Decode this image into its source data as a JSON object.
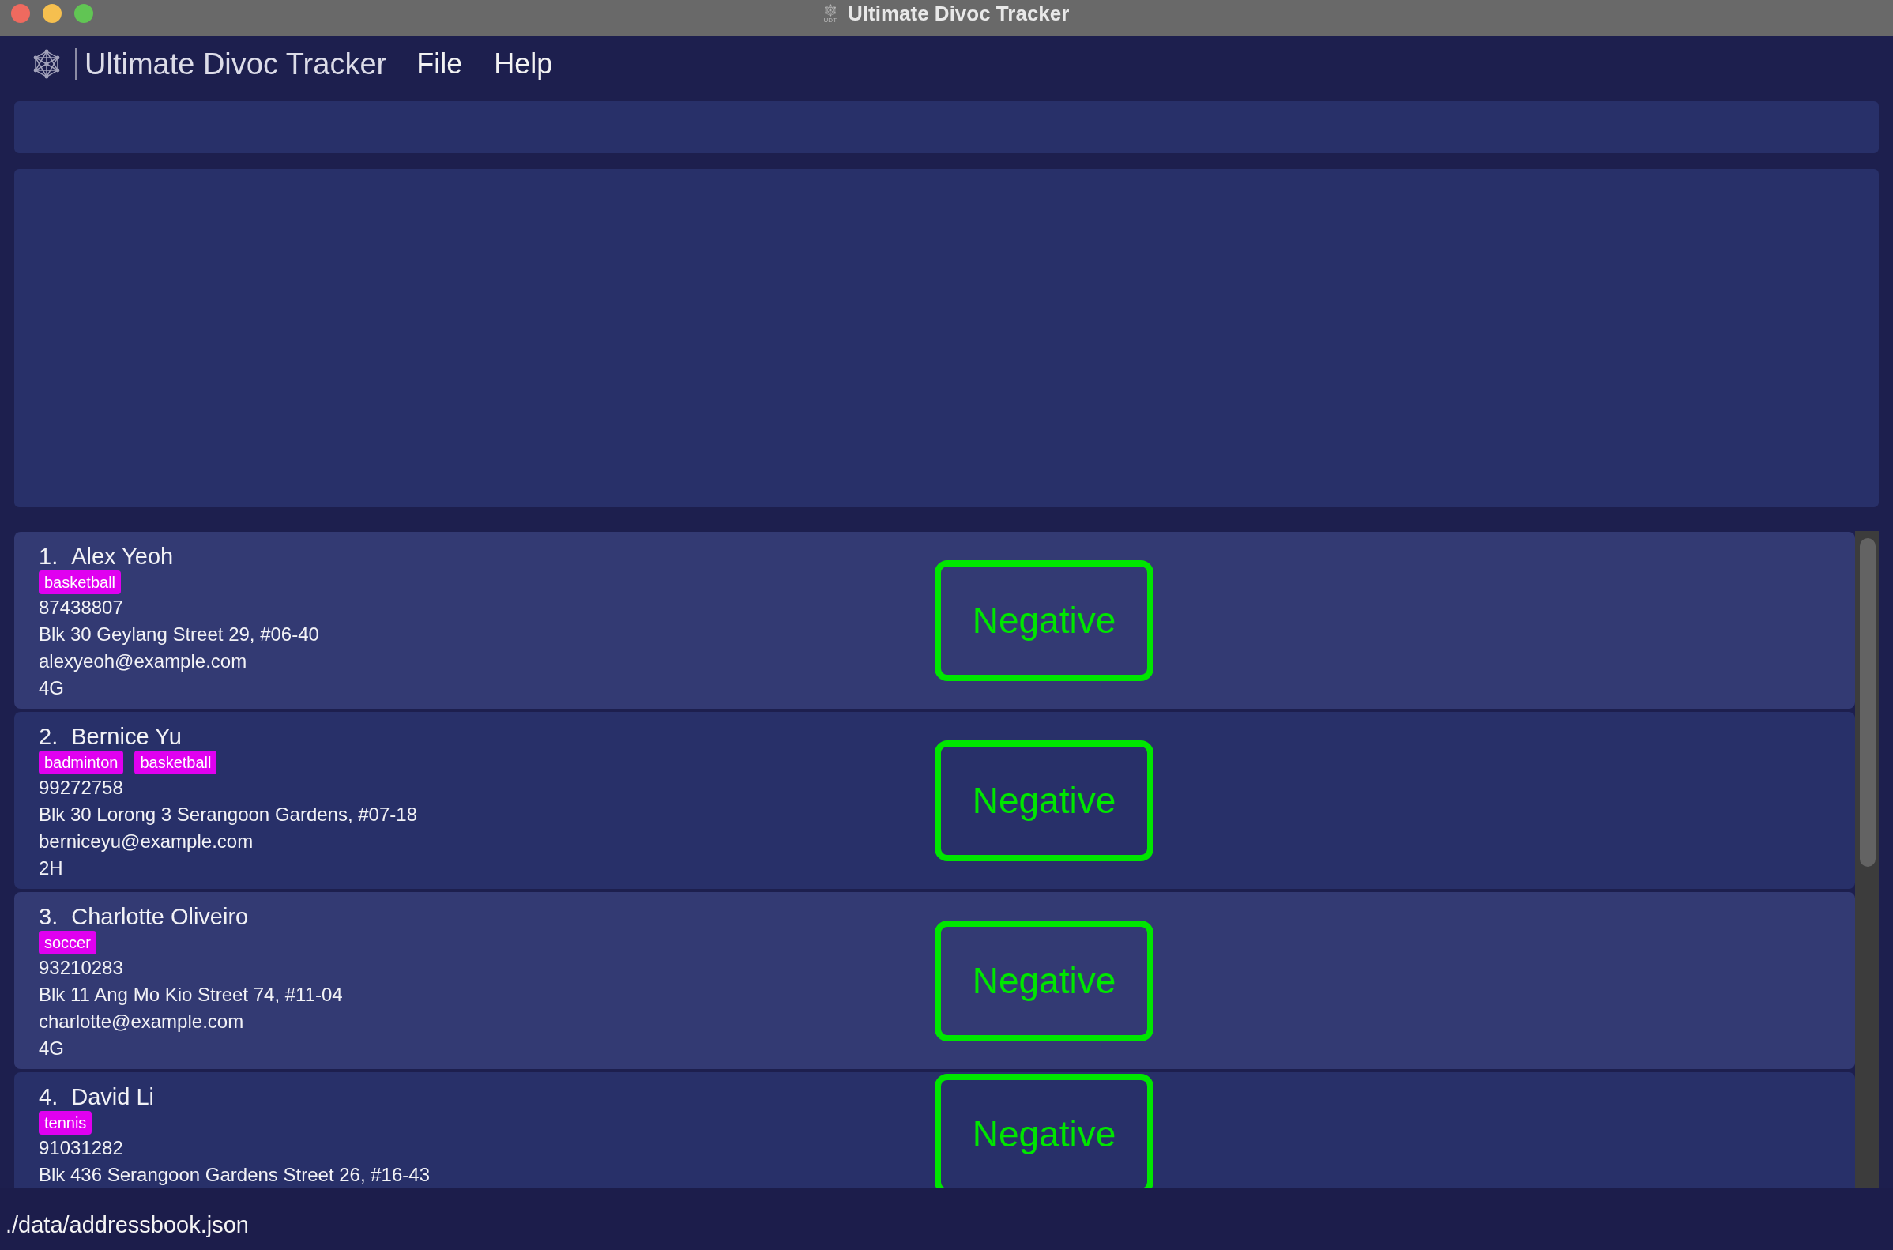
{
  "window": {
    "title": "Ultimate Divoc Tracker",
    "icon_caption": "UDT"
  },
  "menu_bar": {
    "app_name": "Ultimate Divoc Tracker",
    "menus": [
      "File",
      "Help"
    ]
  },
  "persons": [
    {
      "index": "1.",
      "name": "Alex Yeoh",
      "tags": [
        "basketball"
      ],
      "phone": "87438807",
      "address": "Blk 30 Geylang Street 29, #06-40",
      "email": "alexyeoh@example.com",
      "class": "4G",
      "status": "Negative"
    },
    {
      "index": "2.",
      "name": "Bernice Yu",
      "tags": [
        "badminton",
        "basketball"
      ],
      "phone": "99272758",
      "address": "Blk 30 Lorong 3 Serangoon Gardens, #07-18",
      "email": "berniceyu@example.com",
      "class": "2H",
      "status": "Negative"
    },
    {
      "index": "3.",
      "name": "Charlotte Oliveiro",
      "tags": [
        "soccer"
      ],
      "phone": "93210283",
      "address": "Blk 11 Ang Mo Kio Street 74, #11-04",
      "email": "charlotte@example.com",
      "class": "4G",
      "status": "Negative"
    },
    {
      "index": "4.",
      "name": "David Li",
      "tags": [
        "tennis"
      ],
      "phone": "91031282",
      "address": "Blk 436 Serangoon Gardens Street 26, #16-43",
      "status": "Negative"
    }
  ],
  "status_bar": {
    "file_path": "./data/addressbook.json"
  }
}
